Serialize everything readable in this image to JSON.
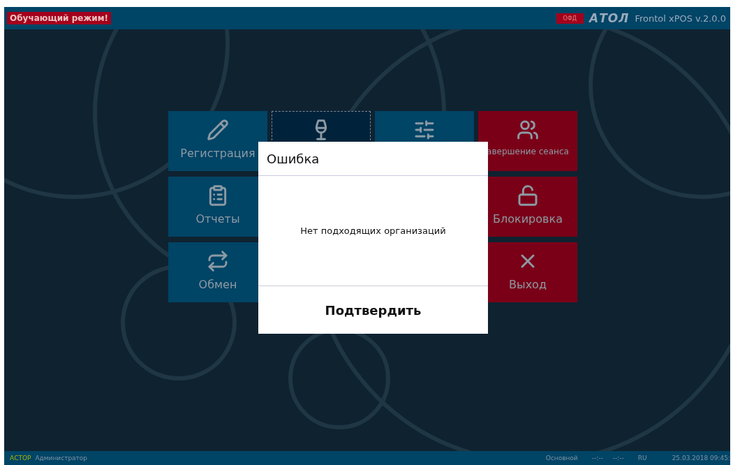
{
  "top_bar": {
    "mode_badge": "Обучающий режим!",
    "ofd_badge": "ОФД",
    "logo": "АТОЛ",
    "app_title": "Frontol xPOS v.2.0.0"
  },
  "tiles": [
    {
      "kind": "tile",
      "label": "Регистрация",
      "color": "#004466",
      "selected": false
    },
    {
      "kind": "tile",
      "color": "#00223a",
      "selected": true
    },
    {
      "kind": "tile",
      "color": "#004466",
      "selected": false
    },
    {
      "kind": "tile",
      "label": "авершение сеанса",
      "color": "#7a0018",
      "selected": false
    },
    {
      "kind": "tile",
      "label": "Отчеты",
      "color": "#004466",
      "selected": false
    },
    {
      "kind": "hidden"
    },
    {
      "kind": "hidden"
    },
    {
      "kind": "tile",
      "label": "Блокировка",
      "color": "#7a0018",
      "selected": false
    },
    {
      "kind": "tile",
      "label": "Обмен",
      "color": "#004466",
      "selected": false
    },
    {
      "kind": "hidden"
    },
    {
      "kind": "hidden"
    },
    {
      "kind": "tile",
      "label": "Выход",
      "color": "#7a0018",
      "selected": false
    }
  ],
  "dialog": {
    "title": "Ошибка",
    "message": "Нет подходящих организаций",
    "button": "Подтвердить"
  },
  "status_bar": {
    "company": "АСТОР",
    "user": "Администратор",
    "profile": "Основной",
    "time_1": "--:--",
    "time_2": "--:--",
    "language": "RU",
    "datetime": "25.03.2018 09:45:"
  }
}
